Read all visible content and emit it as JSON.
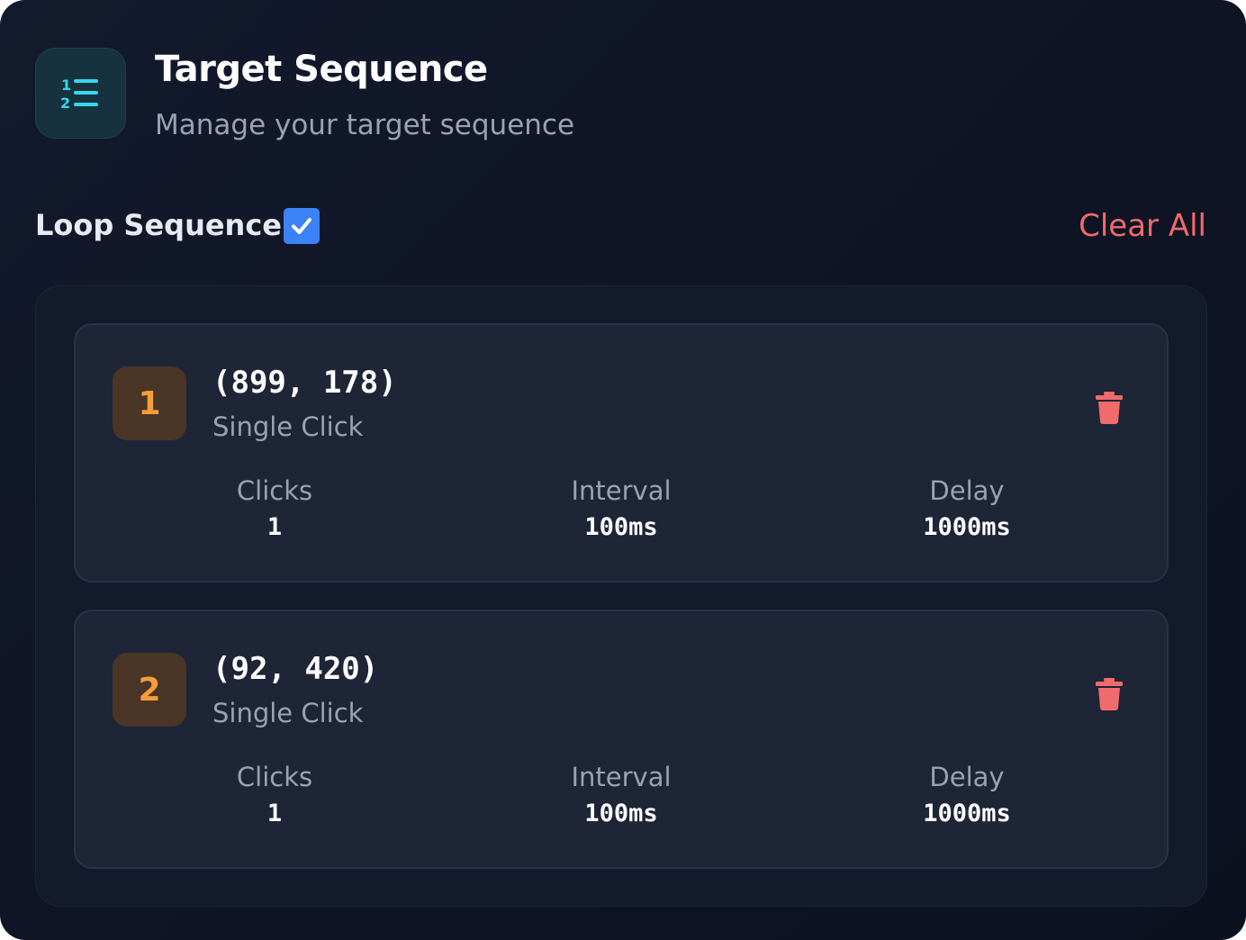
{
  "header": {
    "icon": "ordered-list-icon",
    "title": "Target Sequence",
    "subtitle": "Manage your target sequence"
  },
  "controls": {
    "loop_label": "Loop Sequence",
    "loop_checked": true,
    "clear_all_label": "Clear All"
  },
  "targets": [
    {
      "index": "1",
      "coords": "(899, 178)",
      "click_type": "Single Click",
      "stats": {
        "clicks_label": "Clicks",
        "clicks_value": "1",
        "interval_label": "Interval",
        "interval_value": "100ms",
        "delay_label": "Delay",
        "delay_value": "1000ms"
      }
    },
    {
      "index": "2",
      "coords": "(92, 420)",
      "click_type": "Single Click",
      "stats": {
        "clicks_label": "Clicks",
        "clicks_value": "1",
        "interval_label": "Interval",
        "interval_value": "100ms",
        "delay_label": "Delay",
        "delay_value": "1000ms"
      }
    }
  ],
  "colors": {
    "accent_blue": "#3b82f6",
    "danger": "#f06b6b",
    "badge_text": "#f59e3a",
    "icon_cyan": "#38d6f0"
  }
}
